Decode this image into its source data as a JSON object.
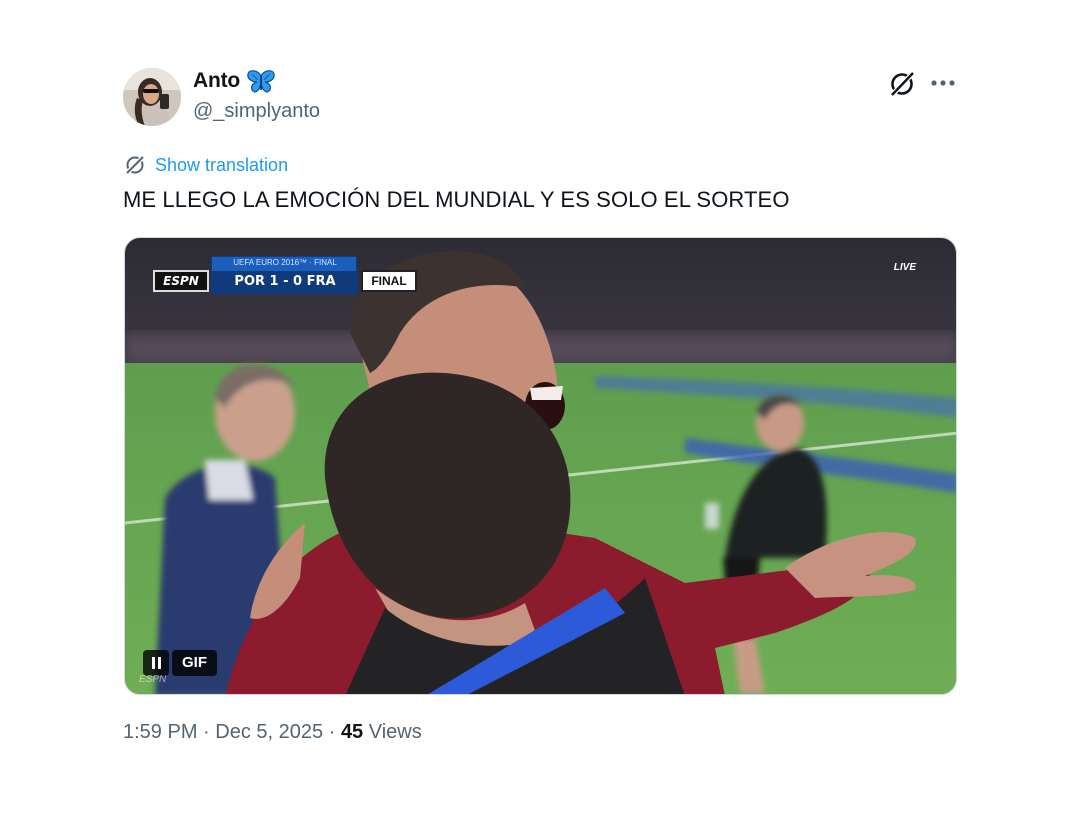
{
  "author": {
    "display_name": "Anto",
    "handle": "@_simplyanto",
    "badge_icon": "butterfly-emoji-icon",
    "badge_color": "#1d9bf0"
  },
  "header_actions": {
    "grok_icon": "grok-icon",
    "more_icon": "more-icon"
  },
  "translation": {
    "label": "Show translation",
    "icon": "translate-icon",
    "color": "#1d9bf0"
  },
  "tweet": {
    "text": "ME LLEGO LA EMOCIÓN DEL MUNDIAL Y ES SOLO EL SORTEO"
  },
  "media": {
    "type": "gif",
    "badge_label": "GIF",
    "pause_icon": "pause-icon",
    "scorebug": {
      "channel": "ESPN",
      "event": "UEFA EURO 2016™ · FINAL",
      "score": "POR 1 - 0 FRA",
      "status": "FINAL"
    },
    "live_label": "LIVE",
    "watermark": "ESPN"
  },
  "meta": {
    "time": "1:59 PM",
    "separator": "·",
    "date": "Dec 5, 2025",
    "views_count": "45",
    "views_label": "Views"
  },
  "colors": {
    "text_primary": "#0f1419",
    "text_secondary": "#536471",
    "accent": "#1d9bf0"
  }
}
